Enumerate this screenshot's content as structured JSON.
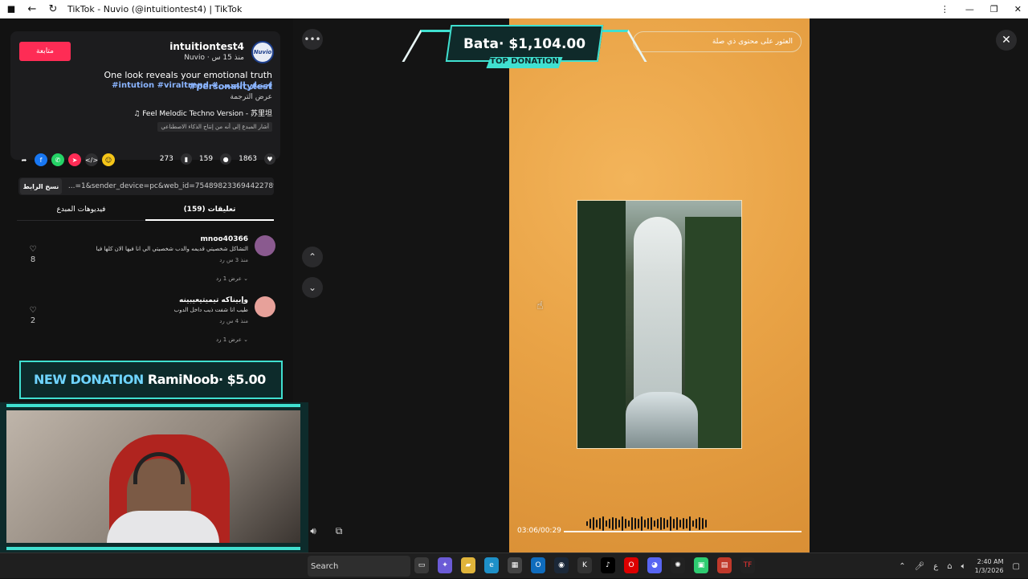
{
  "window": {
    "title": "TikTok - Nuvio (@intuitiontest4) | TikTok",
    "controls": [
      "⋮",
      "—",
      "❐",
      "✕"
    ]
  },
  "post": {
    "follow_label": "متابعة",
    "avatar_text": "Nuvio",
    "username": "intuitiontest4",
    "subline": "Nuvio · منذ 15 س",
    "caption_line1": "One look reveals your emotional truth",
    "caption_tag1": "#personalitytest",
    "caption_line2": "#intution #viraltrend #اختبار_الحدس",
    "translate": "عرض الترجمة",
    "music": "♫ Feel Melodic Techno Version - 苏里坦",
    "ai_note": "أشار المبدع إلى أنه من إنتاج الذكاء الاصطناعي"
  },
  "stats": {
    "likes": "1863",
    "comments": "159",
    "saves": "273"
  },
  "share_icons": [
    "share-arrow",
    "facebook",
    "whatsapp",
    "telegram",
    "embed",
    "coin"
  ],
  "link": {
    "copy_label": "نسخ الرابط",
    "url": "...=1&sender_device=pc&web_id=7548982336944227896"
  },
  "tabs": {
    "creator_videos": "فيديوهات المبدع",
    "comments": "(159) تعليقات"
  },
  "comments": [
    {
      "name": "mnoo40366",
      "text": "التشاكل شخصيتي قديمه والدب شخصيتي الي انا فيها الان كلها فيا",
      "meta": "منذ 3 س     رد",
      "reply": "عرض 1 رد ⌄",
      "likes": "8",
      "avatar_color": "#8a5a8f"
    },
    {
      "name": "وإبيناكه تيميتيعيبينه",
      "text": "طيب انا شفت ذيب داخل الدوب",
      "meta": "منذ 4 س     رد",
      "reply": "عرض 1 رد ⌄",
      "likes": "2",
      "avatar_color": "#e7a19a"
    }
  ],
  "video": {
    "banner": "العثور على محتوى ذي صلة",
    "time": "03:06/00:29",
    "progress": 1.0
  },
  "overlays": {
    "top_donation_amount": "Bata· $1,104.00",
    "top_donation_label": "TOP DONATION",
    "new_donation_label": "NEW DONATION",
    "new_donation_amount": "RamiNoob· $5.00"
  },
  "taskbar": {
    "search_label": "Search",
    "apps": [
      "task-view",
      "copilot",
      "explorer",
      "edge",
      "store",
      "outlook",
      "steam",
      "app-k",
      "tiktok",
      "opera",
      "discord",
      "chatgpt",
      "app-green",
      "app-box",
      "app-tf"
    ],
    "lang": "ع",
    "time": "2:40 AM",
    "date": "1/3/2026"
  },
  "colors": {
    "accent_red": "#fe2c55",
    "teal": "#40e0d0",
    "link_blue": "#8ab4ff"
  }
}
